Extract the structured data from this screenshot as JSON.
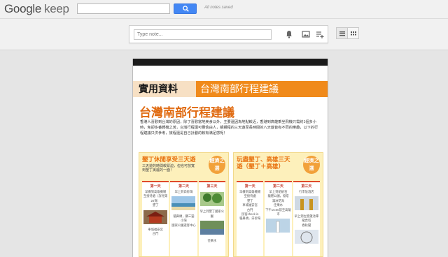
{
  "app": {
    "logo_google": "Google",
    "logo_keep": "keep",
    "save_status": "All notes saved"
  },
  "search": {
    "value": "",
    "button_icon": "search-icon"
  },
  "toolbar": {
    "note_placeholder": "Type note...",
    "reminder_icon": "bell-icon",
    "image_icon": "image-icon",
    "list_icon": "checklist-add-icon",
    "view_list_icon": "list-view-icon",
    "view_grid_icon": "grid-view-icon"
  },
  "note": {
    "section_label": "實用資料",
    "section_title": "台灣南部行程建議",
    "headline": "台灣南部行程建議",
    "intro": "香港人喜歡到台灣的原因，除了喜歡當地美食以外，主要還因為地點較近，香港到高雄乘坐飛機只需約1個多小時，免卻多番轉機之苦，台灣行程還可豐儉由人，靚靚程的三天遊至長時間的八天遊皆有不同的樂趣，以下的行程建議只供參考，旅程還是自己計劃的較有滿足感呢！",
    "columns": [
      {
        "title": "墾丁休閒享受三天遊",
        "subtitle": "三天遊的時間較緊迫，但也可放寬到墾丁美麗的一面！",
        "badge": "經濟之選",
        "days": [
          {
            "label": "第一天",
            "items": [
              "早機到高雄機場",
              "至接待處（詳見第20頁）",
              "墾丁",
              "車城福安宮",
              "古門"
            ]
          },
          {
            "label": "第二天",
            "items": [
              "早上到白砂灣",
              "貓鼻頭，鵝三鑾",
              "小灣",
              "國家公園遊客中心"
            ]
          },
          {
            "label": "第三天",
            "items": [
              "早上到墾丁國家公園",
              "佳樂水"
            ]
          }
        ]
      },
      {
        "title": "玩盡墾丁、高雄三天遊（墾丁＋高雄）",
        "subtitle": "",
        "badge": "經濟之選",
        "days": [
          {
            "label": "第一天",
            "items": [
              "早機到高雄機場",
              "至接待處",
              "墾丁",
              "車城福安宮",
              "古門",
              "民宿check in",
              "貓鼻頭，白砂灣"
            ]
          },
          {
            "label": "第二天",
            "items": [
              "早上到船帆石",
              "龍磐公園，燈塔",
              "滿洲花海",
              "佳樂水",
              "下午15:00前至高雄市"
            ]
          },
          {
            "label": "第三天",
            "items": [
              "行李放酒店",
              "早上到左營蓮池潭",
              "龍虎塔",
              "春秋閣"
            ]
          }
        ]
      }
    ]
  },
  "colors": {
    "accent_orange": "#f08a1b",
    "headline_orange": "#e06a10",
    "search_blue": "#4387f4"
  }
}
